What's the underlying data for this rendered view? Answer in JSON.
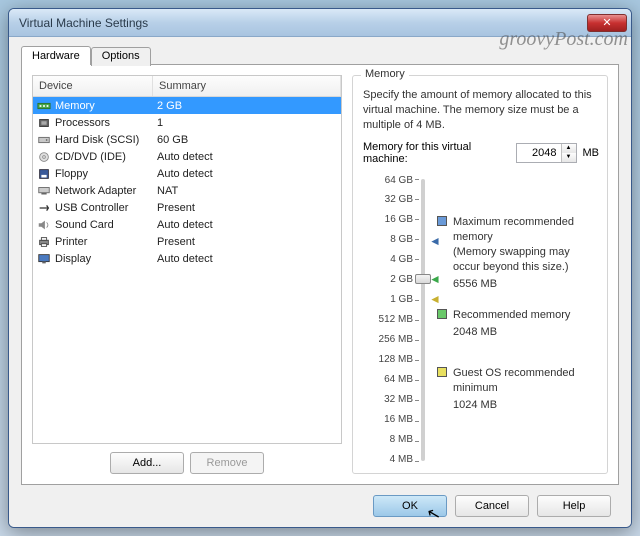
{
  "watermark": "groovyPost.com",
  "window": {
    "title": "Virtual Machine Settings"
  },
  "tabs": {
    "hardware": "Hardware",
    "options": "Options"
  },
  "list": {
    "header_device": "Device",
    "header_summary": "Summary",
    "rows": [
      {
        "name": "Memory",
        "summary": "2 GB",
        "icon": "memory",
        "selected": true
      },
      {
        "name": "Processors",
        "summary": "1",
        "icon": "cpu"
      },
      {
        "name": "Hard Disk (SCSI)",
        "summary": "60 GB",
        "icon": "hdd"
      },
      {
        "name": "CD/DVD (IDE)",
        "summary": "Auto detect",
        "icon": "cd"
      },
      {
        "name": "Floppy",
        "summary": "Auto detect",
        "icon": "floppy"
      },
      {
        "name": "Network Adapter",
        "summary": "NAT",
        "icon": "net"
      },
      {
        "name": "USB Controller",
        "summary": "Present",
        "icon": "usb"
      },
      {
        "name": "Sound Card",
        "summary": "Auto detect",
        "icon": "sound"
      },
      {
        "name": "Printer",
        "summary": "Present",
        "icon": "printer"
      },
      {
        "name": "Display",
        "summary": "Auto detect",
        "icon": "display"
      }
    ]
  },
  "buttons": {
    "add": "Add...",
    "remove": "Remove",
    "ok": "OK",
    "cancel": "Cancel",
    "help": "Help"
  },
  "memory": {
    "group_label": "Memory",
    "desc": "Specify the amount of memory allocated to this virtual machine. The memory size must be a multiple of 4 MB.",
    "input_label": "Memory for this virtual machine:",
    "value": "2048",
    "unit": "MB",
    "scale": [
      "64 GB",
      "32 GB",
      "16 GB",
      "8 GB",
      "4 GB",
      "2 GB",
      "1 GB",
      "512 MB",
      "256 MB",
      "128 MB",
      "64 MB",
      "32 MB",
      "16 MB",
      "8 MB",
      "4 MB"
    ],
    "legend": {
      "max": {
        "label": "Maximum recommended memory",
        "sub": "(Memory swapping may occur beyond this size.)",
        "value": "6556 MB"
      },
      "rec": {
        "label": "Recommended memory",
        "value": "2048 MB"
      },
      "min": {
        "label": "Guest OS recommended minimum",
        "value": "1024 MB"
      }
    }
  }
}
